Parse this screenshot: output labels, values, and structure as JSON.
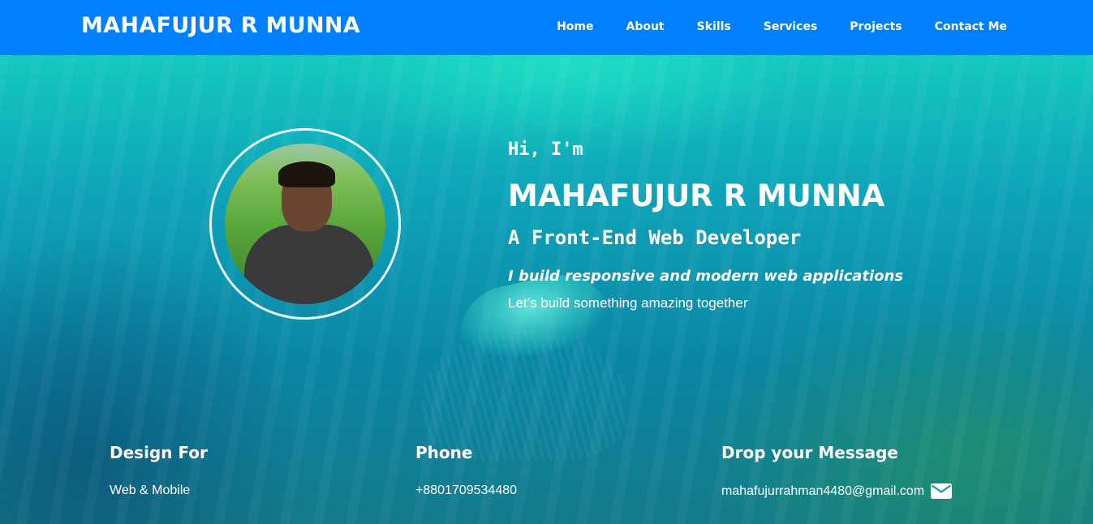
{
  "nav": {
    "brand": "MAHAFUJUR R MUNNA",
    "links": [
      "Home",
      "About",
      "Skills",
      "Services",
      "Projects",
      "Contact Me"
    ]
  },
  "hero": {
    "greeting": "Hi, I'm",
    "name": "MAHAFUJUR R MUNNA",
    "role": "A Front-End Web Developer",
    "tagline": "I build responsive and modern web applications",
    "subline": "Let’s build something amazing together",
    "avatar_alt": "profile-photo"
  },
  "info": [
    {
      "title": "Design For",
      "value": "Web & Mobile"
    },
    {
      "title": "Phone",
      "value": "+8801709534480"
    },
    {
      "title": "Drop your Message",
      "value": "mahafujurrahman4480@gmail.com",
      "icon": "envelope-icon"
    }
  ],
  "colors": {
    "navbar": "#0080ff",
    "text": "#ffffff"
  }
}
